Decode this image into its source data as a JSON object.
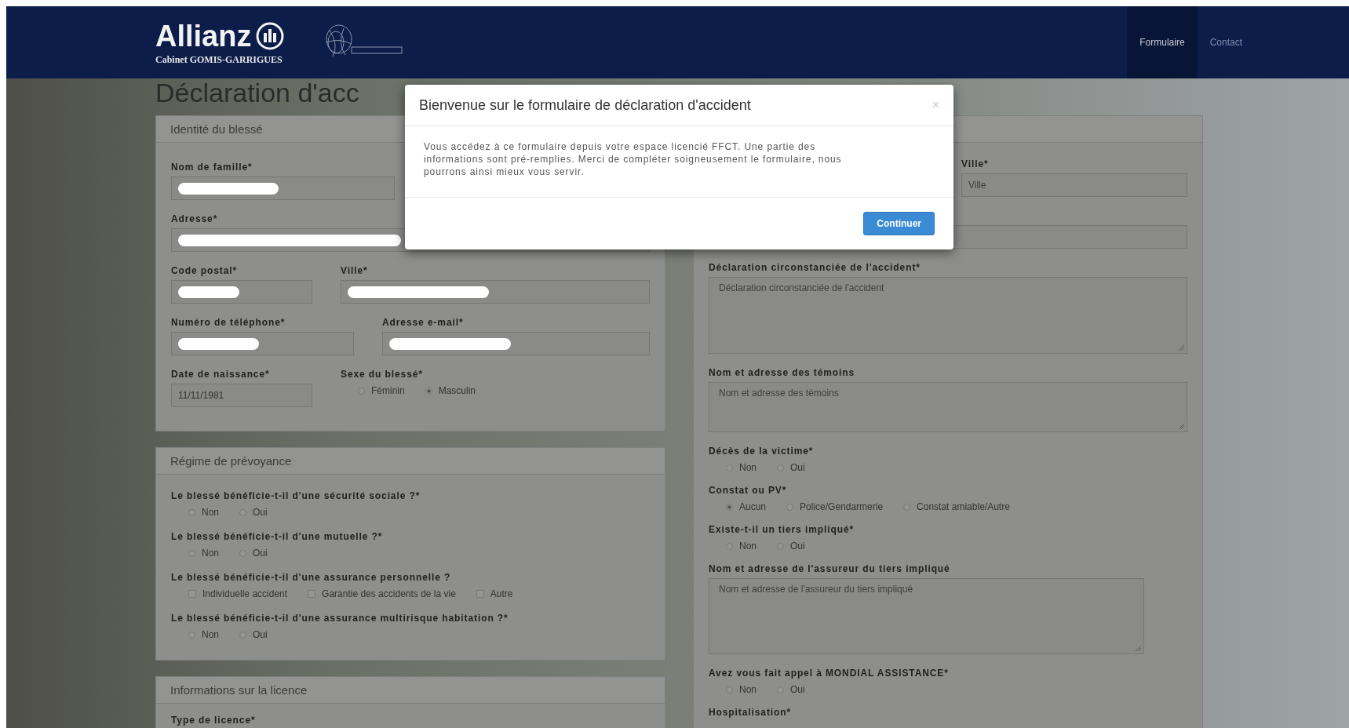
{
  "nav": {
    "brand": "Allianz",
    "brand_subtitle": "Cabinet GOMIS-GARRIGUES",
    "links": [
      {
        "label": "Formulaire",
        "selected": true
      },
      {
        "label": "Contact",
        "selected": false
      }
    ]
  },
  "page_title": "Déclaration d'acc",
  "left_panels": [
    {
      "title": "Identité du blessé",
      "rows": [
        [
          {
            "kind": "input",
            "label": "Nom de famille*",
            "redacted": true
          }
        ],
        [
          {
            "kind": "input",
            "label": "Adresse*",
            "redacted": true
          }
        ],
        [
          {
            "kind": "input",
            "label": "Code postal*",
            "redacted": true
          },
          {
            "kind": "input",
            "label": "Ville*",
            "redacted": true
          }
        ],
        [
          {
            "kind": "input",
            "label": "Numéro de téléphone*",
            "redacted": true
          },
          {
            "kind": "input",
            "label": "Adresse e-mail*",
            "redacted": true
          }
        ],
        [
          {
            "kind": "input",
            "label": "Date de naissance*",
            "value": "11/11/1981",
            "redacted": false
          },
          {
            "kind": "radio",
            "label": "Sexe du blessé*",
            "options": [
              {
                "label": "Féminin",
                "selected": false
              },
              {
                "label": "Masculin",
                "selected": true
              }
            ]
          }
        ]
      ]
    },
    {
      "title": "Régime de prévoyance",
      "rows": [
        [
          {
            "kind": "radio",
            "label": "Le blessé bénéficie-t-il d'une sécurité sociale ?*",
            "options": [
              {
                "label": "Non",
                "selected": false
              },
              {
                "label": "Oui",
                "selected": false
              }
            ]
          }
        ],
        [
          {
            "kind": "radio",
            "label": "Le blessé bénéficie-t-il d'une mutuelle ?*",
            "options": [
              {
                "label": "Non",
                "selected": false
              },
              {
                "label": "Oui",
                "selected": false
              }
            ]
          }
        ],
        [
          {
            "kind": "checkbox",
            "label": "Le blessé bénéficie-t-il d'une assurance personnelle ?",
            "options": [
              {
                "label": "Individuelle accident",
                "checked": false
              },
              {
                "label": "Garantie des accidents de la vie",
                "checked": false
              },
              {
                "label": "Autre",
                "checked": false
              }
            ]
          }
        ],
        [
          {
            "kind": "radio",
            "label": "Le blessé bénéficie-t-il d'une assurance multirisque habitation ?*",
            "options": [
              {
                "label": "Non",
                "selected": false
              },
              {
                "label": "Oui",
                "selected": false
              }
            ]
          }
        ]
      ]
    },
    {
      "title": "Informations sur la licence",
      "rows": [
        [
          {
            "kind": "label",
            "label": "Type de licence*"
          }
        ]
      ]
    }
  ],
  "right_panel": {
    "rows": [
      [
        {
          "kind": "input",
          "label": "Ville*",
          "placeholder": "Ville",
          "redacted": false
        }
      ],
      [
        {
          "kind": "input"
        }
      ],
      [
        {
          "kind": "textarea",
          "label": "Déclaration circonstanciée de l'accident*",
          "placeholder": "Déclaration circonstanciée de l'accident"
        }
      ],
      [
        {
          "kind": "textarea",
          "label": "Nom et adresse des témoins",
          "placeholder": "Nom et adresse des témoins"
        }
      ],
      [
        {
          "kind": "radio",
          "label": "Décès de la victime*",
          "options": [
            {
              "label": "Non",
              "selected": false
            },
            {
              "label": "Oui",
              "selected": false
            }
          ]
        }
      ],
      [
        {
          "kind": "radio",
          "label": "Constat ou PV*",
          "options": [
            {
              "label": "Aucun",
              "selected": true
            },
            {
              "label": "Police/Gendarmerie",
              "selected": false
            },
            {
              "label": "Constat amiable/Autre",
              "selected": false
            }
          ]
        }
      ],
      [
        {
          "kind": "radio",
          "label": "Existe-t-il un tiers impliqué*",
          "options": [
            {
              "label": "Non",
              "selected": false
            },
            {
              "label": "Oui",
              "selected": false
            }
          ]
        }
      ],
      [
        {
          "kind": "textarea",
          "label": "Nom et adresse de l'assureur du tiers impliqué",
          "placeholder": "Nom et adresse de l'assureur du tiers impliqué"
        }
      ],
      [
        {
          "kind": "radio",
          "label": "Avez vous fait appel à MONDIAL ASSISTANCE*",
          "options": [
            {
              "label": "Non",
              "selected": false
            },
            {
              "label": "Oui",
              "selected": false
            }
          ]
        }
      ],
      [
        {
          "kind": "label",
          "label": "Hospitalisation*"
        }
      ]
    ]
  },
  "modal": {
    "title": "Bienvenue sur le formulaire de déclaration d'accident",
    "close": "×",
    "body": "Vous accédez à ce formulaire depuis votre espace licencié FFCT. Une partie des informations sont pré-remplies. Merci de compléter soigneusement le formulaire, nous pourrons ainsi mieux vous servir.",
    "button": "Continuer"
  }
}
